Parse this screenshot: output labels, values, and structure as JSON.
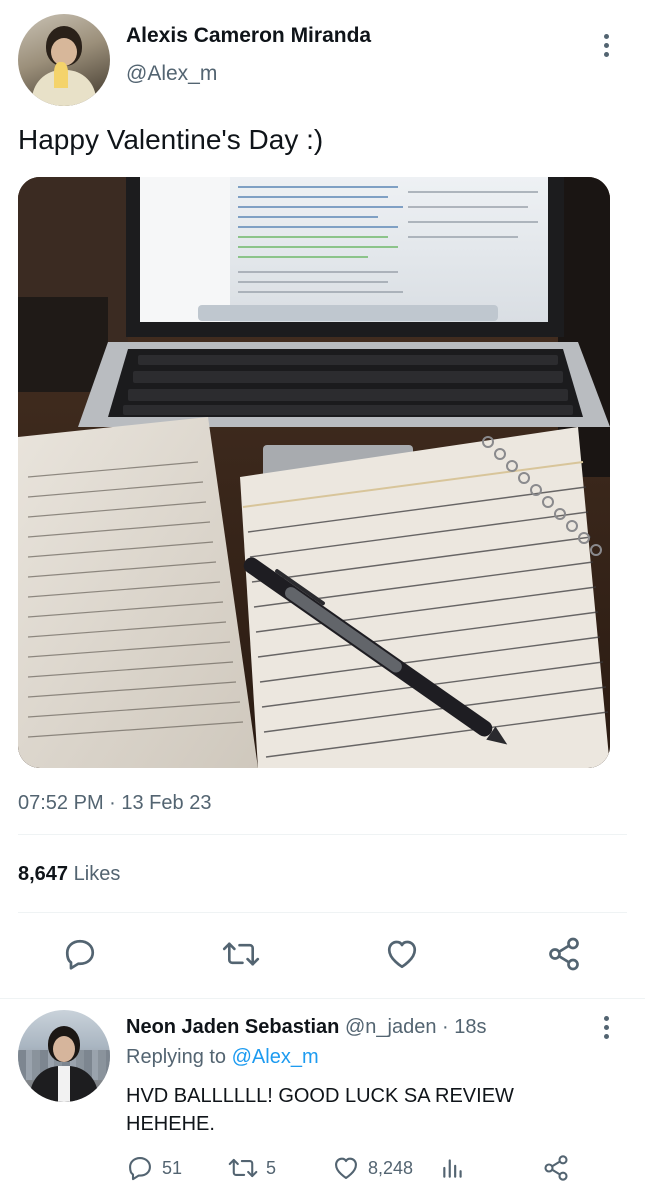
{
  "tweet": {
    "author_name": "Alexis Cameron Miranda",
    "author_handle": "@Alex_m",
    "text": "Happy Valentine's Day :)",
    "timestamp": "07:52 PM · 13 Feb 23",
    "likes_count": "8,647",
    "likes_label": "Likes",
    "actions": [
      "reply-icon",
      "retweet-icon",
      "like-icon",
      "share-icon"
    ]
  },
  "reply": {
    "author_name": "Neon Jaden Sebastian",
    "author_handle": "@n_jaden",
    "separator": "·",
    "time": "18s",
    "replying_prefix": "Replying to",
    "replying_to": "@Alex_m",
    "text": "HVD BALLLLLL! GOOD LUCK SA REVIEW HEHEHE.",
    "reply_count": "51",
    "retweet_count": "5",
    "like_count": "8,248",
    "icons": [
      "comment-icon",
      "retweet-icon",
      "heart-icon",
      "analytics-icon",
      "share-icon"
    ]
  },
  "colors": {
    "text_primary": "#0f1419",
    "text_secondary": "#536471",
    "link": "#1d9bf0",
    "divider": "#eff3f4"
  }
}
